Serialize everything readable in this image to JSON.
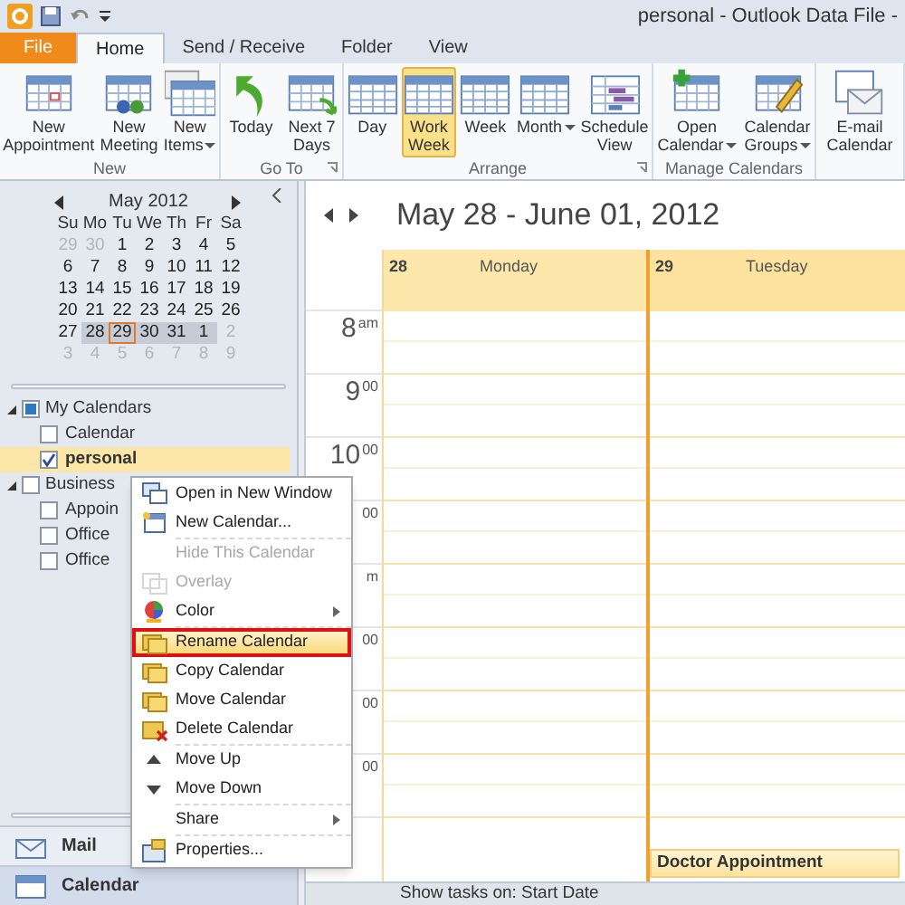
{
  "window": {
    "title": "personal - Outlook Data File -"
  },
  "ribbon_tabs": [
    {
      "label": "File",
      "kind": "file",
      "selected": false
    },
    {
      "label": "Home",
      "kind": "tab",
      "selected": true
    },
    {
      "label": "Send / Receive",
      "kind": "tab",
      "selected": false
    },
    {
      "label": "Folder",
      "kind": "tab",
      "selected": false
    },
    {
      "label": "View",
      "kind": "tab",
      "selected": false
    }
  ],
  "ribbon_groups": [
    {
      "label": "New",
      "launcher": false,
      "buttons": [
        {
          "lines": [
            "New",
            "Appointment"
          ],
          "dropdown": false,
          "selected": false
        },
        {
          "lines": [
            "New",
            "Meeting"
          ],
          "dropdown": false,
          "selected": false
        },
        {
          "lines": [
            "New",
            "Items"
          ],
          "dropdown": true,
          "selected": false
        }
      ]
    },
    {
      "label": "Go To",
      "launcher": true,
      "buttons": [
        {
          "lines": [
            "Today"
          ],
          "dropdown": false,
          "selected": false
        },
        {
          "lines": [
            "Next 7",
            "Days"
          ],
          "dropdown": false,
          "selected": false
        }
      ]
    },
    {
      "label": "Arrange",
      "launcher": true,
      "buttons": [
        {
          "lines": [
            "Day"
          ],
          "dropdown": false,
          "selected": false
        },
        {
          "lines": [
            "Work",
            "Week"
          ],
          "dropdown": false,
          "selected": true
        },
        {
          "lines": [
            "Week"
          ],
          "dropdown": false,
          "selected": false
        },
        {
          "lines": [
            "Month"
          ],
          "dropdown": true,
          "selected": false
        },
        {
          "lines": [
            "Schedule",
            "View"
          ],
          "dropdown": false,
          "selected": false
        }
      ]
    },
    {
      "label": "Manage Calendars",
      "launcher": false,
      "buttons": [
        {
          "lines": [
            "Open",
            "Calendar"
          ],
          "dropdown": true,
          "selected": false
        },
        {
          "lines": [
            "Calendar",
            "Groups"
          ],
          "dropdown": true,
          "selected": false
        }
      ]
    },
    {
      "launcher": false,
      "buttons": [
        {
          "lines": [
            "E-mail",
            "Calendar"
          ],
          "dropdown": false,
          "selected": false
        }
      ]
    }
  ],
  "mini_calendar": {
    "month": "May 2012",
    "weekdays": [
      "Su",
      "Mo",
      "Tu",
      "We",
      "Th",
      "Fr",
      "Sa"
    ],
    "weeks": [
      [
        {
          "d": "29",
          "muted": true,
          "selected": false,
          "today": false
        },
        {
          "d": "30",
          "muted": true,
          "selected": false,
          "today": false
        },
        {
          "d": "1",
          "muted": false,
          "selected": false,
          "today": false
        },
        {
          "d": "2",
          "muted": false,
          "selected": false,
          "today": false
        },
        {
          "d": "3",
          "muted": false,
          "selected": false,
          "today": false
        },
        {
          "d": "4",
          "muted": false,
          "selected": false,
          "today": false
        },
        {
          "d": "5",
          "muted": false,
          "selected": false,
          "today": false
        }
      ],
      [
        {
          "d": "6",
          "muted": false,
          "selected": false,
          "today": false
        },
        {
          "d": "7",
          "muted": false,
          "selected": false,
          "today": false
        },
        {
          "d": "8",
          "muted": false,
          "selected": false,
          "today": false
        },
        {
          "d": "9",
          "muted": false,
          "selected": false,
          "today": false
        },
        {
          "d": "10",
          "muted": false,
          "selected": false,
          "today": false
        },
        {
          "d": "11",
          "muted": false,
          "selected": false,
          "today": false
        },
        {
          "d": "12",
          "muted": false,
          "selected": false,
          "today": false
        }
      ],
      [
        {
          "d": "13",
          "muted": false,
          "selected": false,
          "today": false
        },
        {
          "d": "14",
          "muted": false,
          "selected": false,
          "today": false
        },
        {
          "d": "15",
          "muted": false,
          "selected": false,
          "today": false
        },
        {
          "d": "16",
          "muted": false,
          "selected": false,
          "today": false
        },
        {
          "d": "17",
          "muted": false,
          "selected": false,
          "today": false
        },
        {
          "d": "18",
          "muted": false,
          "selected": false,
          "today": false
        },
        {
          "d": "19",
          "muted": false,
          "selected": false,
          "today": false
        }
      ],
      [
        {
          "d": "20",
          "muted": false,
          "selected": false,
          "today": false
        },
        {
          "d": "21",
          "muted": false,
          "selected": false,
          "today": false
        },
        {
          "d": "22",
          "muted": false,
          "selected": false,
          "today": false
        },
        {
          "d": "23",
          "muted": false,
          "selected": false,
          "today": false
        },
        {
          "d": "24",
          "muted": false,
          "selected": false,
          "today": false
        },
        {
          "d": "25",
          "muted": false,
          "selected": false,
          "today": false
        },
        {
          "d": "26",
          "muted": false,
          "selected": false,
          "today": false
        }
      ],
      [
        {
          "d": "27",
          "muted": false,
          "selected": false,
          "today": false
        },
        {
          "d": "28",
          "muted": false,
          "selected": true,
          "today": false
        },
        {
          "d": "29",
          "muted": false,
          "selected": true,
          "today": true
        },
        {
          "d": "30",
          "muted": false,
          "selected": true,
          "today": false
        },
        {
          "d": "31",
          "muted": false,
          "selected": true,
          "today": false
        },
        {
          "d": "1",
          "muted": false,
          "selected": true,
          "today": false
        },
        {
          "d": "2",
          "muted": true,
          "selected": false,
          "today": false
        }
      ],
      [
        {
          "d": "3",
          "muted": true,
          "selected": false,
          "today": false
        },
        {
          "d": "4",
          "muted": true,
          "selected": false,
          "today": false
        },
        {
          "d": "5",
          "muted": true,
          "selected": false,
          "today": false
        },
        {
          "d": "6",
          "muted": true,
          "selected": false,
          "today": false
        },
        {
          "d": "7",
          "muted": true,
          "selected": false,
          "today": false
        },
        {
          "d": "8",
          "muted": true,
          "selected": false,
          "today": false
        },
        {
          "d": "9",
          "muted": true,
          "selected": false,
          "today": false
        }
      ]
    ]
  },
  "calendar_tree": [
    {
      "label": "My Calendars",
      "expanded": true,
      "checked": true,
      "children": [
        {
          "label": "Calendar",
          "checked": false,
          "selected": false
        },
        {
          "label": "personal",
          "checked": true,
          "selected": true
        }
      ]
    },
    {
      "label": "Business",
      "expanded": true,
      "checked": false,
      "children": [
        {
          "label": "Appoin",
          "checked": false,
          "selected": false
        },
        {
          "label": "Office",
          "checked": false,
          "selected": false
        },
        {
          "label": "Office",
          "checked": false,
          "selected": false
        }
      ]
    }
  ],
  "navigation": [
    {
      "label": "Mail",
      "selected": false
    },
    {
      "label": "Calendar",
      "selected": true
    }
  ],
  "calendar_view": {
    "range": "May 28 - June 01, 2012",
    "days": [
      {
        "number": "28",
        "name": "Monday",
        "today": false
      },
      {
        "number": "29",
        "name": "Tuesday",
        "today": true,
        "task": "Doctor Appointment"
      }
    ],
    "times": [
      {
        "hour": "8",
        "suffix": "am"
      },
      {
        "hour": "9",
        "suffix": "00"
      },
      {
        "hour": "10",
        "suffix": "00"
      },
      {
        "suffix": "00"
      },
      {
        "suffix": "m"
      },
      {
        "suffix": "00"
      },
      {
        "suffix": "00"
      },
      {
        "suffix": "00"
      }
    ]
  },
  "context_menu": [
    {
      "label": "Open in New Window",
      "disabled": false,
      "submenu": false,
      "highlighted": false
    },
    {
      "label": "New Calendar...",
      "disabled": false,
      "submenu": false,
      "highlighted": false
    },
    {
      "label": "Hide This Calendar",
      "disabled": true,
      "submenu": false,
      "highlighted": false
    },
    {
      "label": "Overlay",
      "disabled": true,
      "submenu": false,
      "highlighted": false
    },
    {
      "label": "Color",
      "disabled": false,
      "submenu": true,
      "highlighted": false
    },
    {
      "label": "Rename Calendar",
      "disabled": false,
      "submenu": false,
      "highlighted": true
    },
    {
      "label": "Copy Calendar",
      "disabled": false,
      "submenu": false,
      "highlighted": false
    },
    {
      "label": "Move Calendar",
      "disabled": false,
      "submenu": false,
      "highlighted": false
    },
    {
      "label": "Delete Calendar",
      "disabled": false,
      "submenu": false,
      "highlighted": false
    },
    {
      "label": "Move Up",
      "disabled": false,
      "submenu": false,
      "highlighted": false
    },
    {
      "label": "Move Down",
      "disabled": false,
      "submenu": false,
      "highlighted": false
    },
    {
      "label": "Share",
      "disabled": false,
      "submenu": true,
      "highlighted": false
    },
    {
      "label": "Properties...",
      "disabled": false,
      "submenu": false,
      "highlighted": false
    }
  ],
  "status_bar": {
    "text": "Show tasks on: Start Date"
  }
}
